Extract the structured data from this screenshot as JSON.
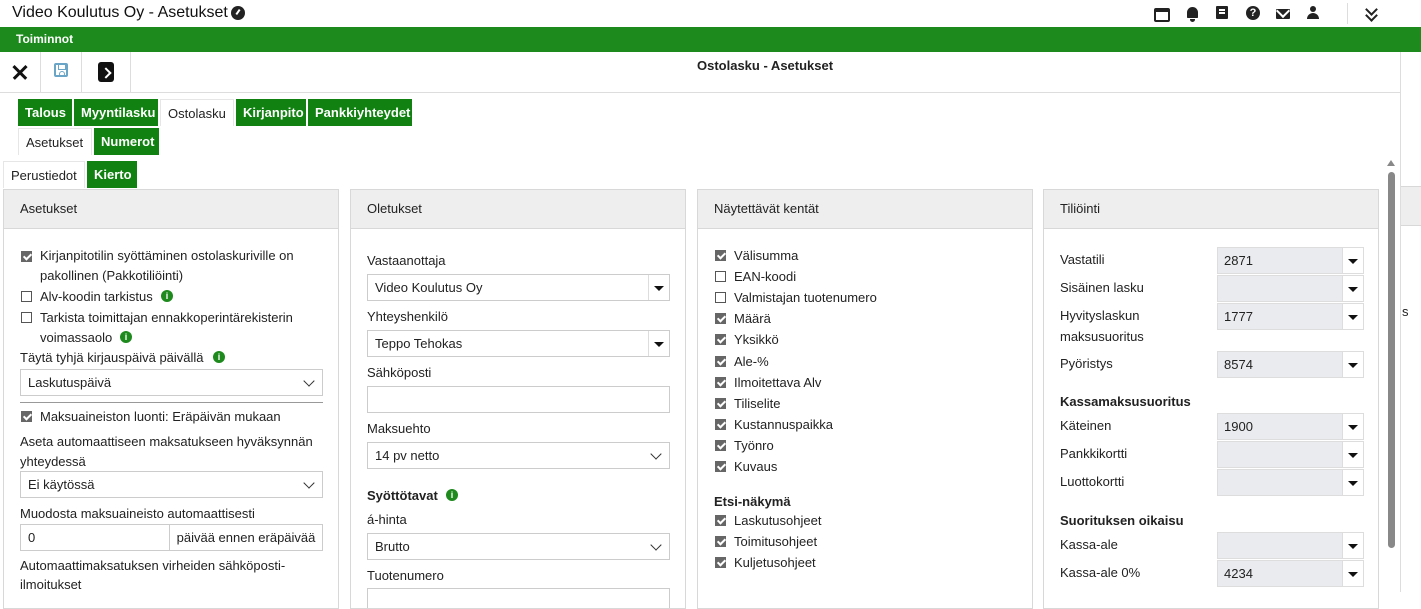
{
  "app": {
    "title": "Video Koulutus Oy - Asetukset",
    "menu_label": "Toiminnot",
    "page_title": "Ostolasku - Asetukset"
  },
  "top_icons": [
    "card-icon",
    "bell-icon",
    "book-icon",
    "help-icon",
    "mail-icon",
    "user-icon",
    "chevrons-down-icon"
  ],
  "tabs_main": [
    "Talous",
    "Myyntilasku",
    "Ostolasku",
    "Kirjanpito",
    "Pankkiyhteydet"
  ],
  "tabs_sub": [
    "Asetukset",
    "Numerot"
  ],
  "tabs_third": [
    "Perustiedot",
    "Kierto"
  ],
  "asetukset": {
    "header": "Asetukset",
    "cb1": "Kirjanpitotilin syöttäminen ostolaskuriville on pakollinen (Pakkotiliöinti)",
    "cb1_l1": "Kirjanpitotilin syöttäminen ostolaskuriville on",
    "cb1_l2": "pakollinen (Pakkotiliöinti)",
    "cb2": "Alv-koodin tarkistus",
    "cb3_l1": "Tarkista toimittajan ennakkoperintärekisterin",
    "cb3_l2": "voimassaolo",
    "fill_label": "Täytä tyhjä kirjauspäivä päivällä",
    "fill_value": "Laskutuspäivä",
    "cb4": "Maksuaineiston luonti: Eräpäivän mukaan",
    "auto_label_l1": "Aseta automaattiseen maksatukseen hyväksynnän",
    "auto_label_l2": "yhteydessä",
    "auto_value": "Ei käytössä",
    "form_label": "Muodosta maksuaineisto automaattisesti",
    "form_value": "0",
    "form_suffix": "päivää ennen eräpäivää",
    "err_l1": "Automaattimaksatuksen virheiden sähköposti-",
    "err_l2": "ilmoitukset"
  },
  "oletukset": {
    "header": "Oletukset",
    "vastaanottaja_label": "Vastaanottaja",
    "vastaanottaja_value": "Video Koulutus Oy",
    "yhteys_label": "Yhteyshenkilö",
    "yhteys_value": "Teppo Tehokas",
    "sposti_label": "Sähköposti",
    "sposti_value": "",
    "maksuehto_label": "Maksuehto",
    "maksuehto_value": "14 pv netto",
    "syotto_heading": "Syöttötavat",
    "ahinta_label": "á-hinta",
    "ahinta_value": "Brutto",
    "tuotenumero_label": "Tuotenumero"
  },
  "naytettavat": {
    "header": "Näytettävät kentät",
    "fields": [
      {
        "label": "Välisumma",
        "checked": true
      },
      {
        "label": "EAN-koodi",
        "checked": false
      },
      {
        "label": "Valmistajan tuotenumero",
        "checked": false
      },
      {
        "label": "Määrä",
        "checked": true
      },
      {
        "label": "Yksikkö",
        "checked": true
      },
      {
        "label": "Ale-%",
        "checked": true
      },
      {
        "label": "Ilmoitettava Alv",
        "checked": true
      },
      {
        "label": "Tiliselite",
        "checked": true
      },
      {
        "label": "Kustannuspaikka",
        "checked": true
      },
      {
        "label": "Työnro",
        "checked": true
      },
      {
        "label": "Kuvaus",
        "checked": true
      }
    ],
    "etsi_heading": "Etsi-näkymä",
    "etsi": [
      {
        "label": "Laskutusohjeet",
        "checked": true
      },
      {
        "label": "Toimitusohjeet",
        "checked": true
      },
      {
        "label": "Kuljetusohjeet",
        "checked": true
      }
    ]
  },
  "tiliointi": {
    "header": "Tiliöinti",
    "rows": [
      {
        "label": "Vastatili",
        "value": "2871"
      },
      {
        "label": "Sisäinen lasku",
        "value": ""
      },
      {
        "label_l1": "Hyvityslaskun",
        "label_l2": "maksusuoritus",
        "value": "1777"
      },
      {
        "label": "Pyöristys",
        "value": "8574"
      }
    ],
    "kassa_heading": "Kassamaksusuoritus",
    "kassa": [
      {
        "label": "Käteinen",
        "value": "1900"
      },
      {
        "label": "Pankkikortti",
        "value": ""
      },
      {
        "label": "Luottokortti",
        "value": ""
      }
    ],
    "oikaisu_heading": "Suorituksen oikaisu",
    "oikaisu": [
      {
        "label": "Kassa-ale",
        "value": ""
      },
      {
        "label": "Kassa-ale 0%",
        "value": "4234"
      }
    ]
  },
  "right_fragment": "s"
}
